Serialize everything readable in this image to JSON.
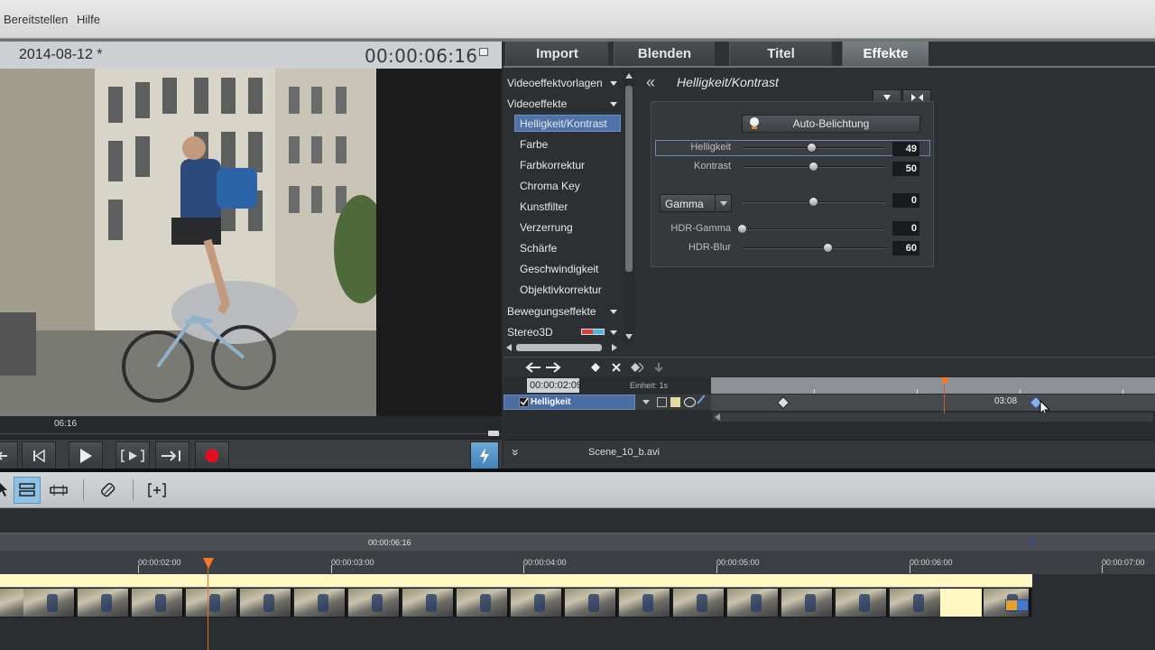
{
  "menubar": {
    "items": [
      "Bereitstellen",
      "Hilfe"
    ]
  },
  "preview": {
    "date": "2014-08-12 *",
    "timecode": "00:00:06:16",
    "scrub_label": "06:16"
  },
  "tabs": [
    {
      "label": "Import",
      "active": false
    },
    {
      "label": "Blenden",
      "active": false
    },
    {
      "label": "Titel",
      "active": false
    },
    {
      "label": "Effekte",
      "active": true
    }
  ],
  "effects": {
    "categories": {
      "vorlagen": "Videoeffektvorlagen",
      "video": "Videoeffekte",
      "bewegung": "Bewegungseffekte",
      "stereo": "Stereo3D"
    },
    "items": [
      "Helligkeit/Kontrast",
      "Farbe",
      "Farbkorrektur",
      "Chroma Key",
      "Kunstfilter",
      "Verzerrung",
      "Schärfe",
      "Geschwindigkeit",
      "Objektivkorrektur"
    ],
    "selected": "Helligkeit/Kontrast",
    "title": "Helligkeit/Kontrast",
    "auto_button": "Auto-Belichtung",
    "params": [
      {
        "label": "Helligkeit",
        "value": "49",
        "level": 0.49
      },
      {
        "label": "Kontrast",
        "value": "50",
        "level": 0.5
      }
    ],
    "gamma": {
      "select_label": "Gamma",
      "value": "0",
      "level": 0.5
    },
    "hdr": [
      {
        "label": "HDR-Gamma",
        "value": "0",
        "level": 0.0
      },
      {
        "label": "HDR-Blur",
        "value": "60",
        "level": 0.6
      }
    ]
  },
  "keyframes": {
    "time": "00:00:02:09",
    "unit_label": "Einheit:",
    "unit_value": "1s",
    "track_label": "Helligkeit",
    "lane_time": "03:08"
  },
  "clip": {
    "filename": "Scene_10_b.avi"
  },
  "timeline": {
    "head_time": "00:00:06:16",
    "ticks": [
      "00:00:02:00",
      "00:00:03:00",
      "00:00:04:00",
      "00:00:05:00",
      "00:00:06:00",
      "00:00:07:00"
    ]
  },
  "colors": {
    "accent_blue": "#4f73a8",
    "playhead_orange": "#f07a28",
    "record_red": "#e0101e"
  },
  "icons": [
    "play-icon",
    "record-icon",
    "lightning-icon",
    "chevron-double-left-icon",
    "diamond-icon",
    "cursor-icon",
    "scissors-icon"
  ]
}
